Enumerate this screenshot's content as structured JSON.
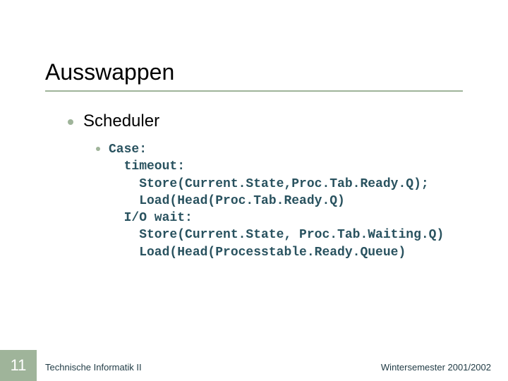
{
  "title": "Ausswappen",
  "body": {
    "heading": "Scheduler",
    "code": "Case:\n  timeout:\n    Store(Current.State,Proc.Tab.Ready.Q);\n    Load(Head(Proc.Tab.Ready.Q)\n  I/O wait:\n    Store(Current.State, Proc.Tab.Waiting.Q)\n    Load(Head(Processtable.Ready.Queue)"
  },
  "footer": {
    "page_number": "11",
    "left": "Technische Informatik II",
    "right": "Wintersemester 2001/2002"
  }
}
